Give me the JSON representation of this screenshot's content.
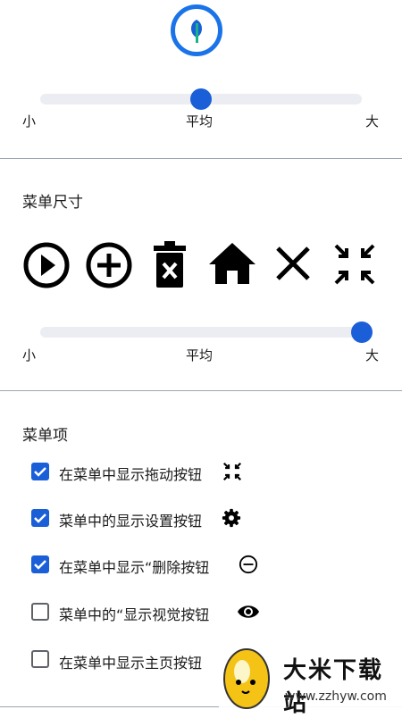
{
  "colors": {
    "accent": "#1a5fd8",
    "track": "#ecedf2",
    "divider": "#9aa7b0"
  },
  "slider1": {
    "min_label": "小",
    "mid_label": "平均",
    "max_label": "大",
    "position": 0.5
  },
  "menu_size": {
    "title": "菜单尺寸",
    "icons": [
      "play-circle-icon",
      "add-circle-icon",
      "delete-icon",
      "home-icon",
      "close-icon",
      "collapse-icon"
    ],
    "slider": {
      "min_label": "小",
      "mid_label": "平均",
      "max_label": "大",
      "position": 1.0
    }
  },
  "menu_items": {
    "title": "菜单项",
    "items": [
      {
        "label": "在菜单中显示拖动按钮",
        "checked": true,
        "icon": "collapse-icon"
      },
      {
        "label": "菜单中的显示设置按钮",
        "checked": true,
        "icon": "gear-icon"
      },
      {
        "label": "在菜单中显示“删除按钮",
        "checked": true,
        "icon": "remove-circle-icon"
      },
      {
        "label": "菜单中的“显示视觉按钮",
        "checked": false,
        "icon": "eye-icon"
      },
      {
        "label": "在菜单中显示主页按钮",
        "checked": false,
        "icon": ""
      }
    ]
  },
  "watermark": {
    "title": "大米下载站",
    "url": "www.zzhyw.com"
  }
}
